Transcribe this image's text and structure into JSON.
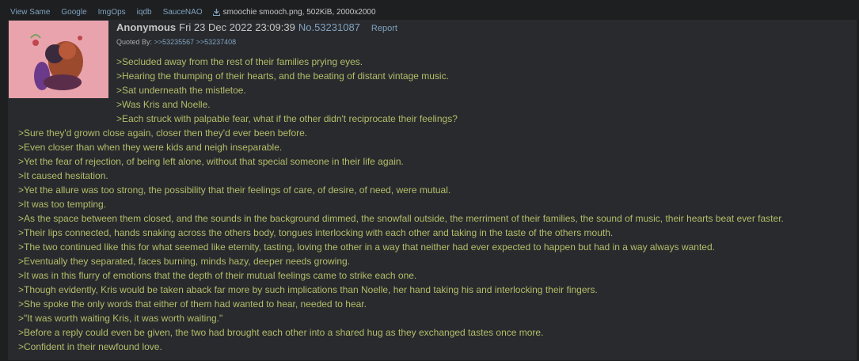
{
  "toolbar": {
    "links": [
      "View Same",
      "Google",
      "ImgOps",
      "iqdb",
      "SauceNAO"
    ],
    "file_name": "smoochie smooch.png",
    "file_meta": ", 502KiB, 2000x2000"
  },
  "post": {
    "name": "Anonymous",
    "datetime": "Fri 23 Dec 2022 23:09:39",
    "post_no": "No.53231087",
    "report_label": "Report",
    "quoted_by_label": "Quoted By:",
    "quoted_by": [
      ">>53235567",
      ">>53237408"
    ],
    "lines": [
      ">Secluded away from the rest of their families prying eyes.",
      ">Hearing the thumping of their hearts, and the beating of distant vintage music.",
      ">Sat underneath the mistletoe.",
      ">Was Kris and Noelle.",
      ">Each struck with palpable fear, what if the other didn't reciprocate their feelings?",
      ">Sure they'd grown close again, closer then they'd ever been before.",
      ">Even closer than when they were kids and neigh inseparable.",
      ">Yet the fear of rejection, of being left alone, without that special someone in their life again.",
      ">It caused hesitation.",
      ">Yet the allure was too strong, the possibility that their feelings of care, of desire, of need, were mutual.",
      ">It was too tempting.",
      ">As the space between them closed, and the sounds in the background dimmed, the snowfall outside, the merriment of their families, the sound of music, their hearts beat ever faster.",
      ">Their lips connected, hands snaking across the others body, tongues interlocking with each other and taking in the taste of the others mouth.",
      ">The two continued like this for what seemed like eternity, tasting, loving the other in a way that neither had ever expected to happen but had in a way always wanted.",
      ">Eventually they separated, faces burning, minds hazy, deeper needs growing.",
      ">It was in this flurry of emotions that the depth of their mutual feelings came to strike each one.",
      ">Though evidently, Kris would be taken aback far more by such implications than Noelle, her hand taking his and interlocking their fingers.",
      ">She spoke the only words that either of them had wanted to hear, needed to hear.",
      ">\"It was worth waiting Kris, it was worth waiting.\"",
      ">Before a reply could even be given, the two had brought each other into a shared hug as they exchanged tastes once more.",
      ">Confident in their newfound love."
    ]
  },
  "colors": {
    "background": "#1d1f21",
    "post_background": "#282a2e",
    "greentext": "#b5bd68",
    "link": "#81a2be",
    "text": "#c5c8c6"
  }
}
